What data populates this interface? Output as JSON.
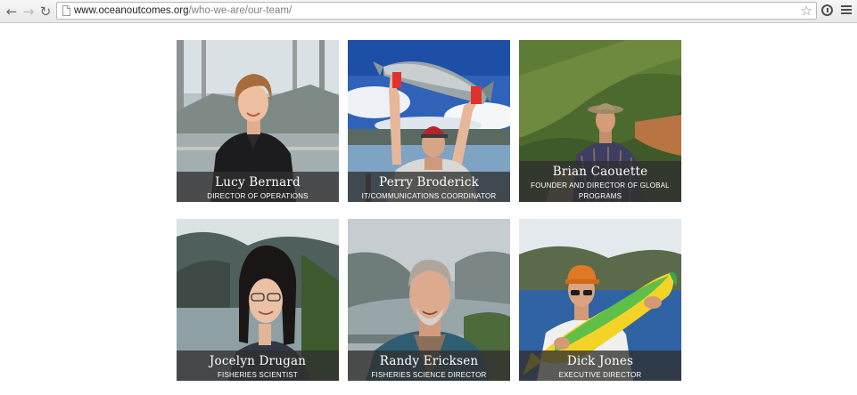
{
  "browser": {
    "url_host": "www.oceanoutcomes.org",
    "url_path": "/who-we-are/our-team/",
    "back_glyph": "←",
    "forward_glyph": "→",
    "reload_glyph": "↻",
    "star_glyph": "☆"
  },
  "team": [
    {
      "name": "Lucy Bernard",
      "role": "Director of Operations",
      "photo_icon": "portrait-photo"
    },
    {
      "name": "Perry Broderick",
      "role": "IT/Communications Coordinator",
      "photo_icon": "portrait-photo"
    },
    {
      "name": "Brian Caouette",
      "role": "Founder and Director of Global Programs",
      "photo_icon": "portrait-photo"
    },
    {
      "name": "Jocelyn Drugan",
      "role": "Fisheries Scientist",
      "photo_icon": "portrait-photo"
    },
    {
      "name": "Randy Ericksen",
      "role": "Fisheries Science Director",
      "photo_icon": "portrait-photo"
    },
    {
      "name": "Dick Jones",
      "role": "Executive Director",
      "photo_icon": "portrait-photo"
    }
  ]
}
